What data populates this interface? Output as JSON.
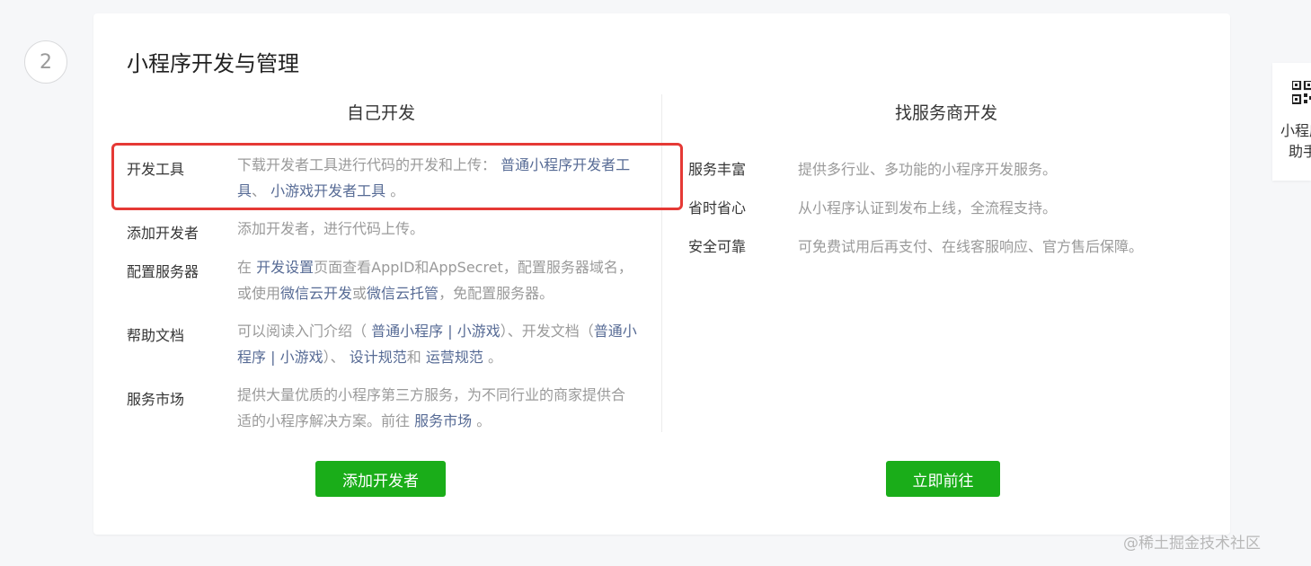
{
  "step": {
    "number": "2"
  },
  "card": {
    "title": "小程序开发与管理",
    "left": {
      "title": "自己开发",
      "rows": [
        {
          "label": "开发工具",
          "d1": "下载开发者工具进行代码的开发和上传：",
          "l1": "普通小程序开发者工具",
          "d2": "、",
          "l2": "小游戏开发者工具",
          "d3": "。"
        },
        {
          "label": "添加开发者",
          "d1": "添加开发者，进行代码上传。"
        },
        {
          "label": "配置服务器",
          "d1": "在",
          "l1": "开发设置",
          "d2": "页面查看AppID和AppSecret，配置服务器域名，或使用",
          "l2": "微信云开发",
          "d3": "或",
          "l3": "微信云托管",
          "d4": "，免配置服务器。"
        },
        {
          "label": "帮助文档",
          "d1": "可以阅读入门介绍（",
          "l1": "普通小程序",
          "s1": "|",
          "l2": "小游戏",
          "d2": "）、开发文档（",
          "l3": "普通小程序",
          "s2": "|",
          "l4": "小游戏",
          "d3": "）、",
          "l5": "设计规范",
          "d4": "和",
          "l6": "运营规范",
          "d5": "。"
        },
        {
          "label": "服务市场",
          "d1": "提供大量优质的小程序第三方服务，为不同行业的商家提供合适的小程序解决方案。前往",
          "l1": "服务市场",
          "d2": "。"
        }
      ],
      "button": "添加开发者"
    },
    "right": {
      "title": "找服务商开发",
      "rows": [
        {
          "label": "服务丰富",
          "desc": "提供多行业、多功能的小程序开发服务。"
        },
        {
          "label": "省时省心",
          "desc": "从小程序认证到发布上线，全流程支持。"
        },
        {
          "label": "安全可靠",
          "desc": "可免费试用后再支付、在线客服响应、官方售后保障。"
        }
      ],
      "button": "立即前往"
    }
  },
  "side_panel": {
    "line1": "小程序",
    "line2": "助手",
    "icon": "qr-code-icon"
  },
  "watermark": "@稀土掘金技术社区",
  "colors": {
    "accent_green": "#1aad19",
    "link": "#576b95",
    "highlight": "#e53935"
  }
}
